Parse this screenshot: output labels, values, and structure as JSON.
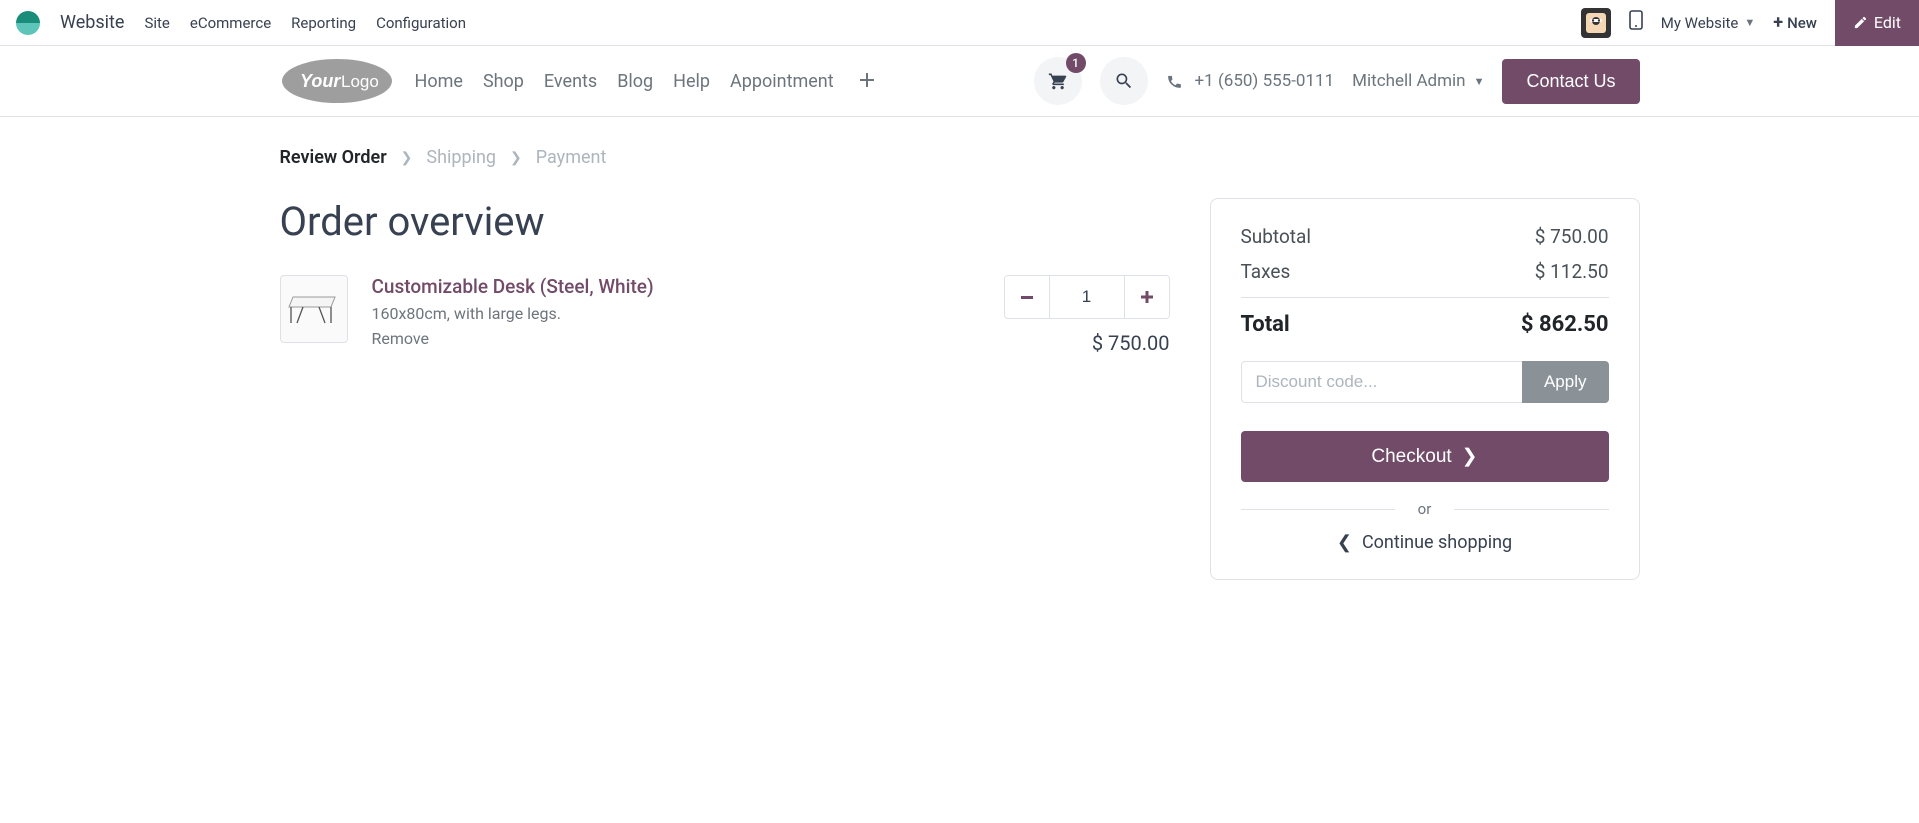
{
  "admin": {
    "app_name": "Website",
    "menu": [
      "Site",
      "eCommerce",
      "Reporting",
      "Configuration"
    ],
    "website_selector": "My Website",
    "new_label": "New",
    "edit_label": "Edit"
  },
  "header": {
    "nav": [
      "Home",
      "Shop",
      "Events",
      "Blog",
      "Help",
      "Appointment"
    ],
    "cart_count": "1",
    "phone": "+1 (650) 555-0111",
    "user": "Mitchell Admin",
    "contact_label": "Contact Us"
  },
  "breadcrumb": {
    "steps": [
      "Review Order",
      "Shipping",
      "Payment"
    ],
    "current_index": 0
  },
  "page_title": "Order overview",
  "item": {
    "name": "Customizable Desk (Steel, White)",
    "desc": "160x80cm, with large legs.",
    "remove_label": "Remove",
    "qty": "1",
    "price": "$ 750.00"
  },
  "summary": {
    "subtotal_label": "Subtotal",
    "subtotal_value": "$ 750.00",
    "taxes_label": "Taxes",
    "taxes_value": "$ 112.50",
    "total_label": "Total",
    "total_value": "$ 862.50",
    "discount_placeholder": "Discount code...",
    "apply_label": "Apply",
    "checkout_label": "Checkout",
    "or_label": "or",
    "continue_label": "Continue shopping"
  },
  "colors": {
    "accent": "#714B67"
  }
}
